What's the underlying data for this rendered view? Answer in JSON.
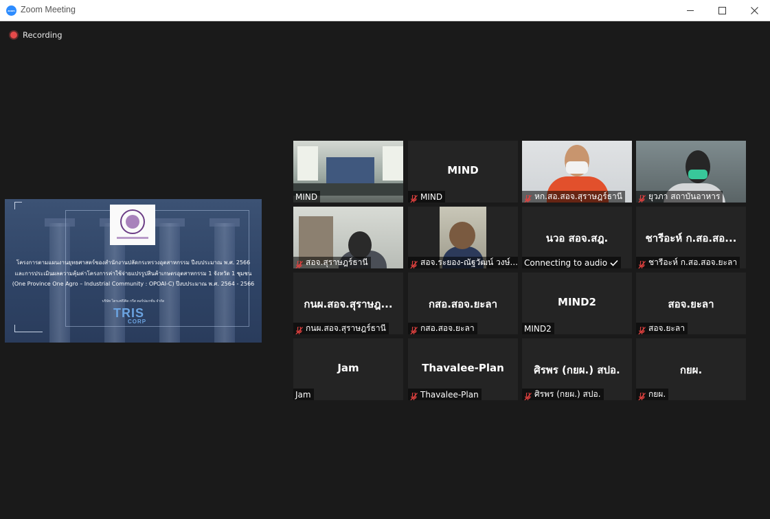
{
  "window": {
    "title": "Zoom Meeting",
    "app_icon_text": "zoom"
  },
  "recording": {
    "label": "Recording"
  },
  "shared_screen": {
    "line1": "โครงการตามแผนงานยุทธศาสตร์ของสำนักงานปลัดกระทรวงอุตสาหกรรม ปีงบประมาณ พ.ศ. 2566",
    "line2": "และการประเมินผลความคุ้มค่าโครงการค่าใช้จ่ายแปรรูปสินค้าเกษตรอุตสาหกรรม 1 จังหวัด 1 ชุมชน",
    "line3": "(One Province One Agro – Industrial Community : OPOAI-C) ปีงบประมาณ พ.ศ. 2564 - 2566",
    "company": "บริษัท ไตรแซ่ปิคิด กรีส คอร์ปอเรชั่น จำกัด",
    "logo_main": "TRIS",
    "logo_sub": "CORP"
  },
  "participants": [
    {
      "label": "MIND",
      "center": "",
      "muted": false,
      "video": "room",
      "active": true
    },
    {
      "label": "MIND",
      "center": "MIND",
      "muted": true,
      "video": "",
      "active": false
    },
    {
      "label": "หก.สอ.สอจ.สุราษฎร์ธานี",
      "center": "",
      "muted": true,
      "video": "orange",
      "active": false
    },
    {
      "label": "ยุวภา สถาบันอาหาร",
      "center": "",
      "muted": true,
      "video": "green",
      "active": false
    },
    {
      "label": "สอจ.สุราษฎร์ธานี",
      "center": "",
      "muted": true,
      "video": "office",
      "active": false
    },
    {
      "label": "สอจ.ระยอง-ณัฐวัฒน์ วงษ์...",
      "center": "",
      "muted": true,
      "video": "narrow",
      "active": false
    },
    {
      "label": "Connecting to audio",
      "center": "นวอ สอจ.สฎ.",
      "muted": false,
      "connecting": true,
      "video": "",
      "active": false
    },
    {
      "label": "ชารีอะห์ ก.สอ.สอจ.ยะลา",
      "center": "ชารีอะห์ ก.สอ.สอ...",
      "muted": true,
      "video": "",
      "active": false
    },
    {
      "label": "กนผ.สอจ.สุราษฎร์ธานี",
      "center": "กนผ.สอจ.สุราษฎ...",
      "muted": true,
      "video": "",
      "active": false
    },
    {
      "label": "กสอ.สอจ.ยะลา",
      "center": "กสอ.สอจ.ยะลา",
      "muted": true,
      "video": "",
      "active": false
    },
    {
      "label": "MIND2",
      "center": "MIND2",
      "muted": false,
      "video": "",
      "active": false
    },
    {
      "label": "สอจ.ยะลา",
      "center": "สอจ.ยะลา",
      "muted": true,
      "video": "",
      "active": false
    },
    {
      "label": "Jam",
      "center": "Jam",
      "muted": false,
      "video": "",
      "active": false
    },
    {
      "label": "Thavalee-Plan",
      "center": "Thavalee-Plan",
      "muted": true,
      "video": "",
      "active": false
    },
    {
      "label": "ศิรพร (กยผ.) สปอ.",
      "center": "ศิรพร (กยผ.) สปอ.",
      "muted": true,
      "video": "",
      "active": false
    },
    {
      "label": "กยผ.",
      "center": "กยผ.",
      "muted": true,
      "video": "",
      "active": false
    }
  ],
  "colors": {
    "active_speaker_outline": "#dfe247",
    "mute_icon": "#e0413f",
    "tile_background": "#242424",
    "app_background": "#1a1a1a"
  }
}
